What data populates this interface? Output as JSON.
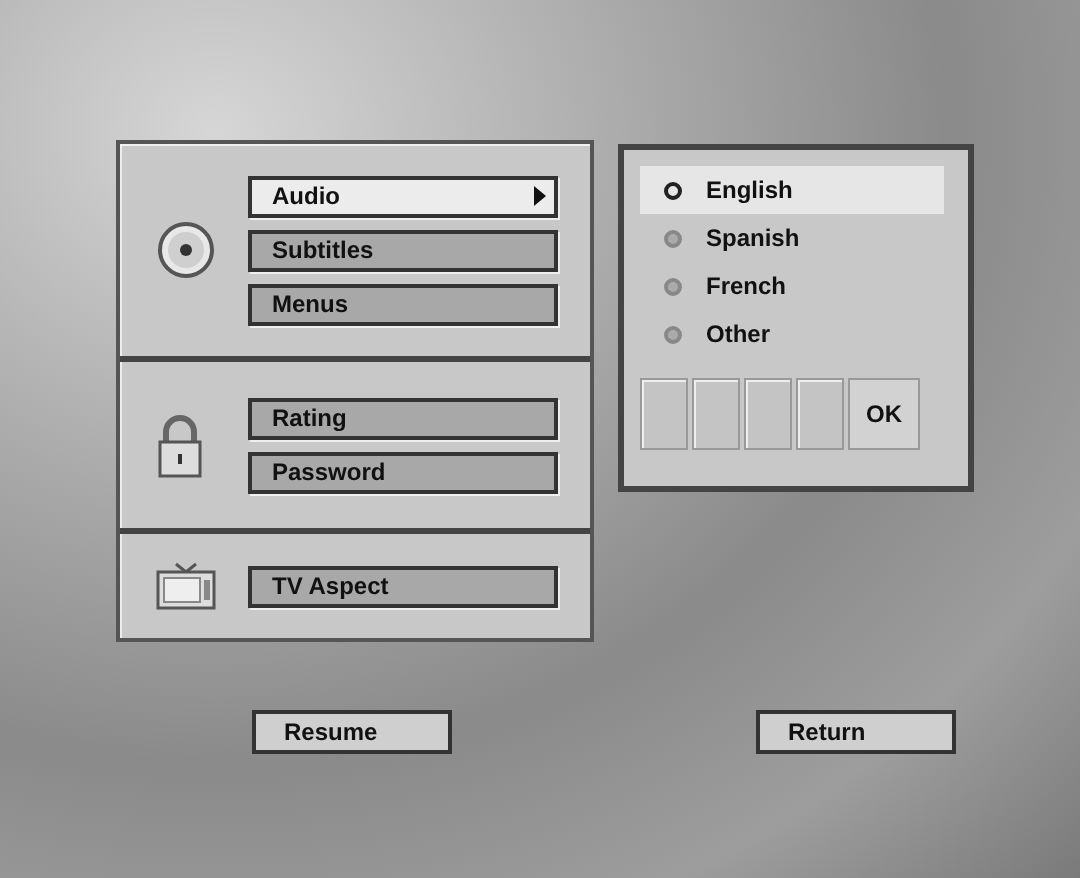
{
  "sections": [
    {
      "kind": "disc",
      "items": [
        {
          "label": "Audio",
          "selected": true
        },
        {
          "label": "Subtitles",
          "selected": false
        },
        {
          "label": "Menus",
          "selected": false
        }
      ]
    },
    {
      "kind": "lock",
      "items": [
        {
          "label": "Rating",
          "selected": false
        },
        {
          "label": "Password",
          "selected": false
        }
      ]
    },
    {
      "kind": "tv",
      "items": [
        {
          "label": "TV Aspect",
          "selected": false
        }
      ]
    }
  ],
  "languages": [
    {
      "label": "English",
      "selected": true
    },
    {
      "label": "Spanish",
      "selected": false
    },
    {
      "label": "French",
      "selected": false
    },
    {
      "label": "Other",
      "selected": false
    }
  ],
  "code_entry": [
    {
      "kind": "field"
    },
    {
      "kind": "field"
    },
    {
      "kind": "field"
    },
    {
      "kind": "field"
    },
    {
      "kind": "ok",
      "label": "OK"
    }
  ],
  "buttons": [
    "Resume",
    "Return"
  ]
}
